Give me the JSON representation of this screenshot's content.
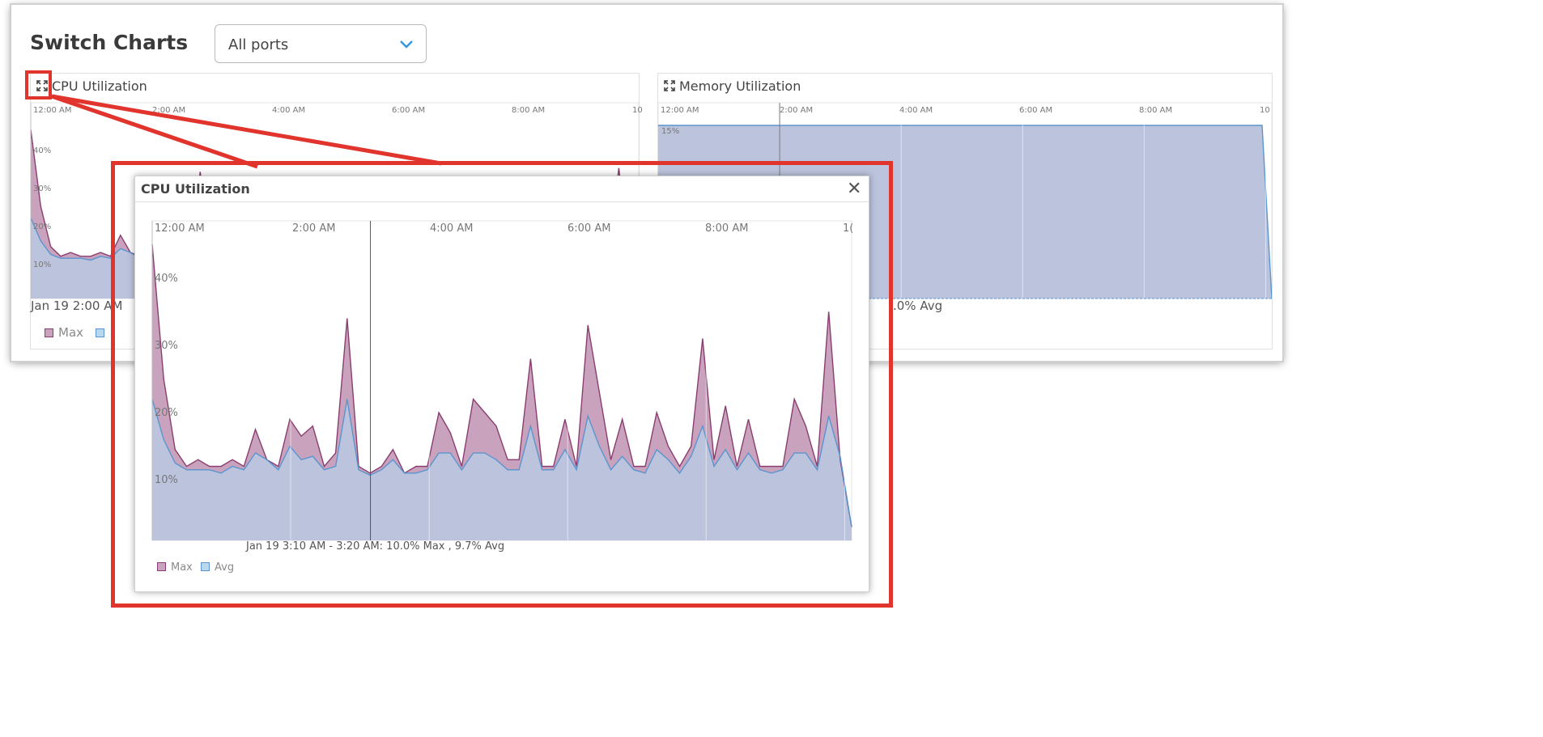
{
  "page_title": "Switch Charts",
  "port_select": {
    "selected": "All ports"
  },
  "cpu_card": {
    "title": "CPU Utilization",
    "x_ticks": [
      "12:00 AM",
      "2:00 AM",
      "4:00 AM",
      "6:00 AM",
      "8:00 AM",
      "10"
    ],
    "y_ticks": [
      "40%",
      "30%",
      "20%",
      "10%"
    ],
    "stat": "Jan 19 2:00 AM",
    "legend": {
      "max": "Max",
      "avg": ""
    }
  },
  "mem_card": {
    "title": "Memory Utilization",
    "x_ticks": [
      "12:00 AM",
      "2:00 AM",
      "4:00 AM",
      "6:00 AM",
      "8:00 AM",
      "10"
    ],
    "y_ticks": [
      "15%"
    ],
    "stat": ".0% Avg"
  },
  "modal": {
    "title": "CPU Utilization",
    "close_glyph": "✕",
    "x_ticks": [
      "12:00 AM",
      "2:00 AM",
      "4:00 AM",
      "6:00 AM",
      "8:00 AM",
      "1("
    ],
    "y_ticks": [
      "40%",
      "30%",
      "20%",
      "10%"
    ],
    "hover_stat": "Jan 19 3:10 AM - 3:20 AM: 10.0% Max , 9.7% Avg",
    "legend": {
      "max": "Max",
      "avg": "Avg"
    }
  },
  "colors": {
    "highlight": "#e0342c",
    "max_fill": "#c9a3bd",
    "max_line": "#8a3d70",
    "avg_fill": "#bcc3dc",
    "avg_line": "#5a95cf"
  },
  "chart_data": {
    "type": "area",
    "title": "CPU Utilization",
    "xlabel": "",
    "ylabel": "",
    "ylim": [
      0,
      45
    ],
    "x_labels": [
      "12:00 AM",
      "2:00 AM",
      "4:00 AM",
      "6:00 AM",
      "8:00 AM"
    ],
    "series": [
      {
        "name": "Max",
        "values": [
          44,
          24,
          13.5,
          11,
          12,
          11,
          11,
          12,
          11,
          16.5,
          12,
          11,
          18,
          15.5,
          17,
          11,
          13,
          33,
          11,
          10,
          11,
          13.5,
          10,
          11,
          11,
          19,
          16,
          11,
          21,
          19,
          17,
          12,
          12,
          27,
          11,
          11,
          18,
          11,
          32,
          22,
          12,
          18,
          11,
          11,
          19,
          14,
          11,
          14,
          30,
          12,
          20,
          11,
          18,
          11,
          11,
          11,
          21,
          17,
          11,
          34,
          12,
          2
        ]
      },
      {
        "name": "Avg",
        "values": [
          21,
          15,
          11.5,
          10.5,
          10.5,
          10.5,
          10,
          11,
          10.5,
          13,
          12,
          10.5,
          14,
          12,
          12.5,
          10.5,
          11,
          21,
          10.5,
          9.7,
          10.5,
          12,
          10,
          10,
          10.5,
          13,
          13,
          10.5,
          13,
          13,
          12,
          10.5,
          10.5,
          17,
          10.5,
          10.5,
          13.5,
          10.5,
          18.5,
          14,
          10.5,
          12.5,
          10.5,
          10,
          13.5,
          12,
          10,
          12.5,
          17,
          11,
          13.5,
          10.5,
          13,
          10.5,
          10,
          10.5,
          13,
          13,
          10.5,
          18.5,
          12.5,
          2
        ]
      }
    ],
    "hover": {
      "x": "Jan 19 3:10 AM - 3:20 AM",
      "max": 10.0,
      "avg": 9.7
    }
  }
}
